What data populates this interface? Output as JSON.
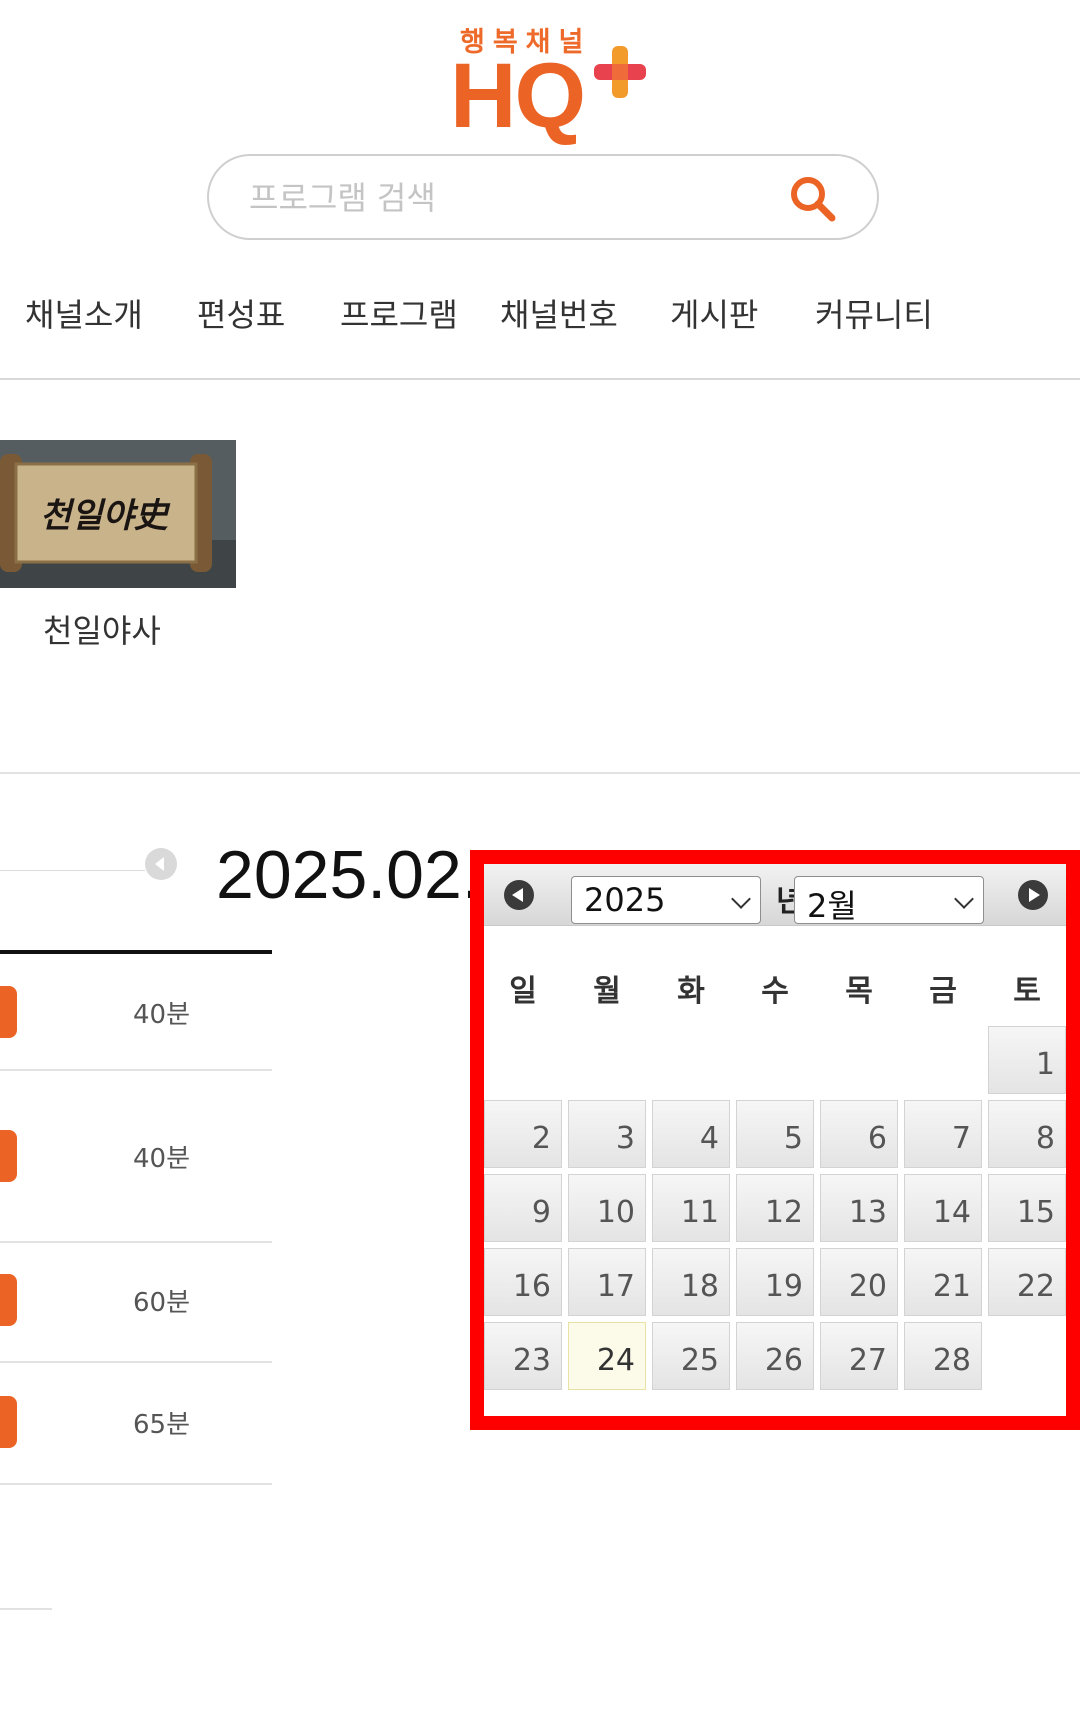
{
  "header": {
    "logo_tagline": "행복채널",
    "logo_text": "HQ",
    "accent_color": "#ec6425"
  },
  "search": {
    "placeholder": "프로그램 검색",
    "icon": "search-icon"
  },
  "nav": {
    "items": [
      "채널소개",
      "편성표",
      "프로그램",
      "채널번호",
      "게시판",
      "커뮤니티"
    ]
  },
  "program": {
    "title": "천일야사",
    "thumbnail_text": "천일야史"
  },
  "schedule": {
    "date_text": "2025.02.",
    "rows": [
      {
        "duration": "40분"
      },
      {
        "duration": "40분"
      },
      {
        "duration": "60분"
      },
      {
        "duration": "65분"
      }
    ]
  },
  "datepicker": {
    "selected_year": "2025",
    "year_unit": "년",
    "selected_month": "2월",
    "weekdays": [
      "일",
      "월",
      "화",
      "수",
      "목",
      "금",
      "토"
    ],
    "days": [
      "1",
      "2",
      "3",
      "4",
      "5",
      "6",
      "7",
      "8",
      "9",
      "10",
      "11",
      "12",
      "13",
      "14",
      "15",
      "16",
      "17",
      "18",
      "19",
      "20",
      "21",
      "22",
      "23",
      "24",
      "25",
      "26",
      "27",
      "28"
    ],
    "today": "24",
    "highlight_color": "#ff0000"
  }
}
